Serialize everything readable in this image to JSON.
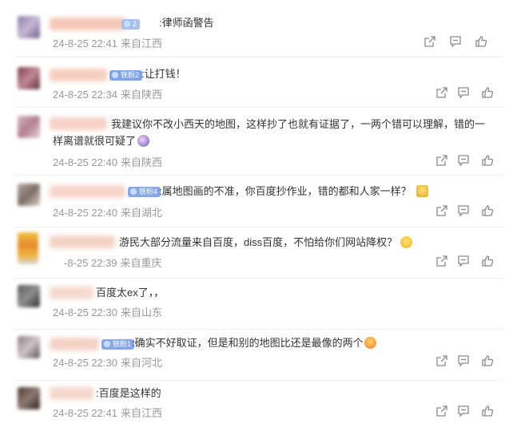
{
  "comments": [
    {
      "text": ":律师函警告",
      "badge": "2",
      "time": "24-8-25 22:41",
      "location": "来自江西",
      "emoji": ""
    },
    {
      "text": ":让打钱！",
      "badge": "铁粉2",
      "time": "24-8-25 22:34",
      "location": "来自陕西",
      "emoji": ""
    },
    {
      "text": "我建议你不改小西天的地图，这样抄了也就有证据了，一两个错可以理解，错的一",
      "text2": "样离谱就很可疑了",
      "badge": "",
      "time": "24-8-25 22:40",
      "location": "来自陕西",
      "emoji": "thinking-emoji"
    },
    {
      "text": ":属地图画的不准，你百度抄作业，错的都和人家一样？",
      "badge": "铁粉4",
      "time": "24-8-25 22:40",
      "location": "来自湖北",
      "emoji": "facepalm-emoji"
    },
    {
      "text": "游民大部分流量来自百度，diss百度，不怕给你们网站降权？",
      "badge": "",
      "time": "-8-25 22:39",
      "location": "来自重庆",
      "emoji": "grin-emoji"
    },
    {
      "text": "百度太ex了，，",
      "badge": "",
      "time": "24-8-25 22:30",
      "location": "来自山东",
      "emoji": ""
    },
    {
      "text": ":确实不好取证，但是和别的地图比还是最像的两个",
      "badge": "铁粉1",
      "time": "24-8-25 22:30",
      "location": "来自河北",
      "emoji": "laugh-emoji"
    },
    {
      "text": ":百度是这样的",
      "badge": "",
      "time": "24-8-25 22:41",
      "location": "来自江西",
      "emoji": ""
    }
  ],
  "icons": {
    "share": "share-icon",
    "comment": "comment-icon",
    "like": "like-icon"
  },
  "colors": {
    "text": "#333333",
    "meta": "#999999",
    "badge": "#86a8e7",
    "icon": "#8a8a8a"
  }
}
